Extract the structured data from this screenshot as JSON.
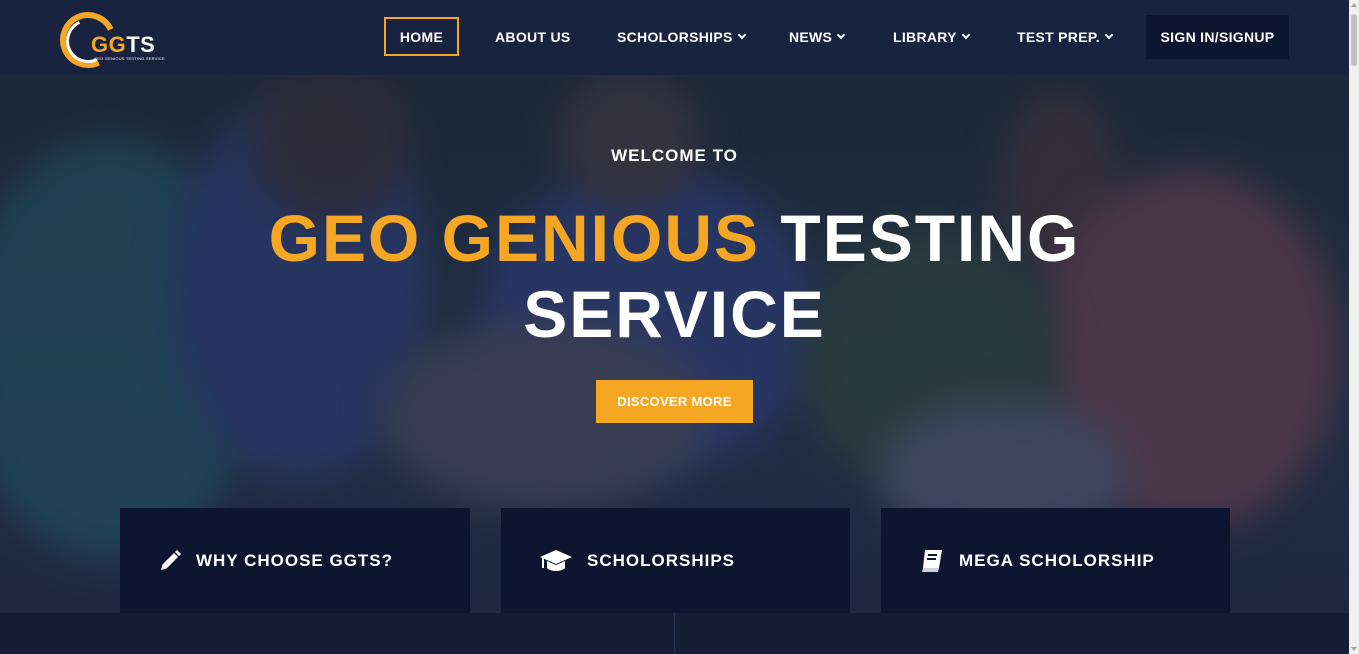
{
  "brand": {
    "logo_text_accent": "GG",
    "logo_text_main": "TS",
    "logo_subtitle": "GEO GENIOUS TESTING SERVICE",
    "accent_color": "#f5a623",
    "navy_color": "#19233f"
  },
  "nav": {
    "home": "HOME",
    "about": "ABOUT US",
    "scholarships": "SCHOLORSHIPS",
    "news": "NEWS",
    "library": "LIBRARY",
    "test_prep": "TEST PREP.",
    "signin": "SIGN IN/SIGNUP"
  },
  "hero": {
    "welcome": "WELCOME TO",
    "title_accent": "GEO GENIOUS",
    "title_main_1": "TESTING",
    "title_main_2": "SERVICE",
    "cta": "DISCOVER MORE"
  },
  "features": [
    {
      "label": "WHY CHOOSE GGTS?",
      "icon": "pencil-icon"
    },
    {
      "label": "SCHOLORSHIPS",
      "icon": "graduation-cap-icon"
    },
    {
      "label": "MEGA SCHOLORSHIP",
      "icon": "book-icon"
    }
  ]
}
